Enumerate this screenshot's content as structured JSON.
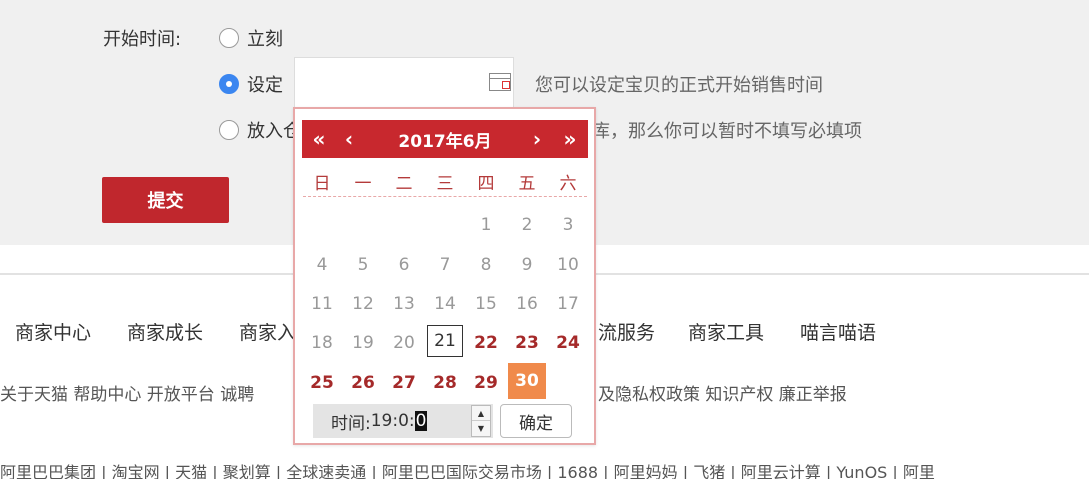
{
  "form": {
    "start_time_label": "开始时间:",
    "options": [
      {
        "label": "立刻",
        "checked": false
      },
      {
        "label": "设定",
        "checked": true
      },
      {
        "label": "放入仓",
        "checked": false
      }
    ],
    "set_hint": "您可以设定宝贝的正式开始销售时间",
    "warehouse_hint": "库，那么你可以暂时不填写必填项",
    "submit_label": "提交"
  },
  "calendar": {
    "title": "2017年6月",
    "prev_year_icon": "«",
    "prev_month_icon": "‹",
    "next_month_icon": "›",
    "next_year_icon": "»",
    "weekdays": [
      "日",
      "一",
      "二",
      "三",
      "四",
      "五",
      "六"
    ],
    "days": {
      "d1": "1",
      "d2": "2",
      "d3": "3",
      "d4": "4",
      "d5": "5",
      "d6": "6",
      "d7": "7",
      "d8": "8",
      "d9": "9",
      "d10": "10",
      "d11": "11",
      "d12": "12",
      "d13": "13",
      "d14": "14",
      "d15": "15",
      "d16": "16",
      "d17": "17",
      "d18": "18",
      "d19": "19",
      "d20": "20",
      "d21": "21",
      "d22": "22",
      "d23": "23",
      "d24": "24",
      "d25": "25",
      "d26": "26",
      "d27": "27",
      "d28": "28",
      "d29": "29",
      "d30": "30"
    },
    "today": "21",
    "selected": "30",
    "time_label": "时间:",
    "time_value": "19:0:",
    "time_cursor_digit": "0",
    "confirm_label": "确定"
  },
  "footer": {
    "nav": [
      "商家中心",
      "商家成长",
      "商家入",
      "流服务",
      "商家工具",
      "喵言喵语"
    ],
    "links_left": "关于天猫  帮助中心  开放平台  诚聘",
    "links_right": "及隐私权政策  知识产权  廉正举报",
    "groups": "阿里巴巴集团 | 淘宝网 | 天猫 | 聚划算 | 全球速卖通 | 阿里巴巴国际交易市场 | 1688 | 阿里妈妈 | 飞猪 | 阿里云计算 | YunOS | 阿里"
  },
  "icons": {
    "calendar": "calendar-icon"
  },
  "colors": {
    "brand_red": "#c8282e",
    "selected_day": "#f08a4b",
    "radio_checked": "#3b86f0"
  }
}
